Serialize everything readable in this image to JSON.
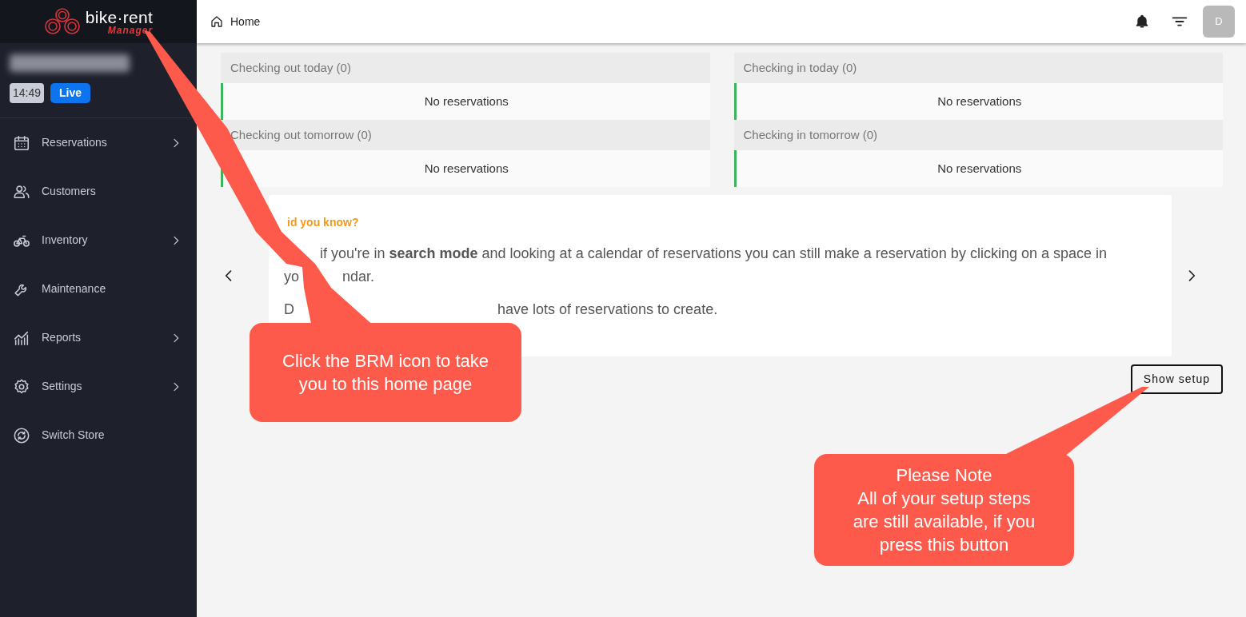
{
  "logo": {
    "name": "bike·rent",
    "subtitle": "Manager"
  },
  "store": {
    "clock": "14:49",
    "status": "Live"
  },
  "sidebar": {
    "items": [
      {
        "label": "Reservations",
        "has_submenu": true
      },
      {
        "label": "Customers",
        "has_submenu": false
      },
      {
        "label": "Inventory",
        "has_submenu": true
      },
      {
        "label": "Maintenance",
        "has_submenu": false
      },
      {
        "label": "Reports",
        "has_submenu": true
      },
      {
        "label": "Settings",
        "has_submenu": true
      },
      {
        "label": "Switch Store",
        "has_submenu": false
      }
    ]
  },
  "topbar": {
    "breadcrumb": "Home",
    "avatar": "D"
  },
  "panels": [
    {
      "title": "Checking out today (0)",
      "message": "No reservations"
    },
    {
      "title": "Checking in today (0)",
      "message": "No reservations"
    },
    {
      "title": "Checking out tomorrow (0)",
      "message": "No reservations"
    },
    {
      "title": "Checking in tomorrow (0)",
      "message": "No reservations"
    }
  ],
  "tip": {
    "title": "id you know?",
    "lines": [
      {
        "parts": [
          "if you're in **search mode** and looking at a calendar of reservations you can still make a reservation by clicking on a space in"
        ]
      },
      {
        "parts": [
          "yo",
          "ndar."
        ]
      },
      {
        "parts": [
          "D",
          "have lots of reservations to create."
        ]
      }
    ]
  },
  "setup_button": "Show setup",
  "callouts": [
    {
      "title": "Click the BRM icon to take you to this home page"
    },
    {
      "title": "Please Note",
      "body": "All of your setup steps are still available, if you press this button"
    }
  ]
}
